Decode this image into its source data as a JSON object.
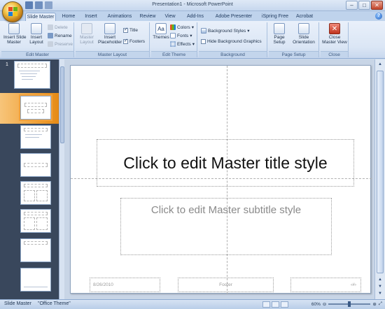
{
  "window": {
    "title": "Presentation1 - Microsoft PowerPoint"
  },
  "tabs": [
    "Slide Master",
    "Home",
    "Insert",
    "Animations",
    "Review",
    "View",
    "Add-Ins",
    "Adobe Presenter",
    "iSpring Free",
    "Acrobat"
  ],
  "ribbon": {
    "edit_master": {
      "label": "Edit Master",
      "insert_slide_master": "Insert Slide\nMaster",
      "insert_layout": "Insert\nLayout",
      "delete": "Delete",
      "rename": "Rename",
      "preserve": "Preserve"
    },
    "master_layout": {
      "label": "Master Layout",
      "master_layout": "Master\nLayout",
      "insert_placeholder": "Insert\nPlaceholder",
      "title": "Title",
      "footers": "Footers",
      "title_checked": true,
      "footers_checked": true
    },
    "edit_theme": {
      "label": "Edit Theme",
      "themes": "Themes",
      "colors": "Colors",
      "fonts": "Fonts",
      "effects": "Effects"
    },
    "background": {
      "label": "Background",
      "background_styles": "Background Styles",
      "hide_background_graphics": "Hide Background Graphics"
    },
    "page_setup": {
      "label": "Page Setup",
      "page_setup": "Page\nSetup",
      "slide_orientation": "Slide\nOrientation"
    },
    "close": {
      "label": "Close",
      "close_master_view": "Close\nMaster View"
    }
  },
  "thumbnails": {
    "master_number": "1"
  },
  "slide": {
    "title_placeholder": "Click to edit Master title style",
    "subtitle_placeholder": "Click to edit Master subtitle style",
    "date": "8/26/2010",
    "footer": "Footer",
    "slide_number": "‹#›"
  },
  "status": {
    "view": "Slide Master",
    "theme": "\"Office Theme\"",
    "zoom": "60%"
  },
  "colors": {
    "accent": "#f0a23a",
    "ribbon": "#dbe6f5",
    "thumb_pane": "#39475c"
  }
}
